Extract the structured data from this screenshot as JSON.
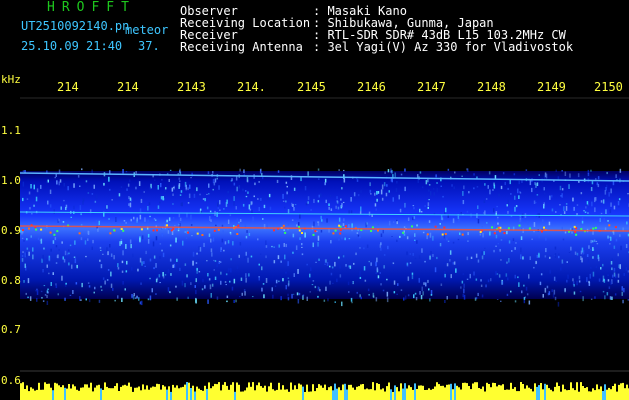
{
  "header": {
    "app_name": "HROFFT",
    "filename": "UT2510092140.pn",
    "mode": "meteor",
    "datetime": "25.10.09 21:40",
    "value": "37.",
    "info_labels": {
      "observer": "Observer",
      "location": "Receiving Location",
      "receiver": "Receiver",
      "antenna": "Receiving Antenna"
    },
    "info_values": {
      "observer": ": Masaki Kano",
      "location": ": Shibukawa, Gunma, Japan",
      "receiver": ": RTL-SDR SDR# 43dB L15 103.2MHz CW",
      "antenna": ": 3el Yagi(V) Az 330 for Vladivostok"
    }
  },
  "axis": {
    "unit": "kHz",
    "x_ticks": [
      "214",
      "214",
      "2143",
      "214.",
      "2145",
      "2146",
      "2147",
      "2148",
      "2149",
      "2150"
    ],
    "y_ticks": [
      "1.1",
      "1.0",
      "0.9",
      "0.8",
      "0.7",
      "0.6"
    ]
  },
  "colors": {
    "label_green": "#1ec81e",
    "label_cyan": "#3ec6ff",
    "tick_yellow": "#ffff40",
    "spectrum_bg": "#00008a",
    "signal_line": "#ff4040"
  }
}
